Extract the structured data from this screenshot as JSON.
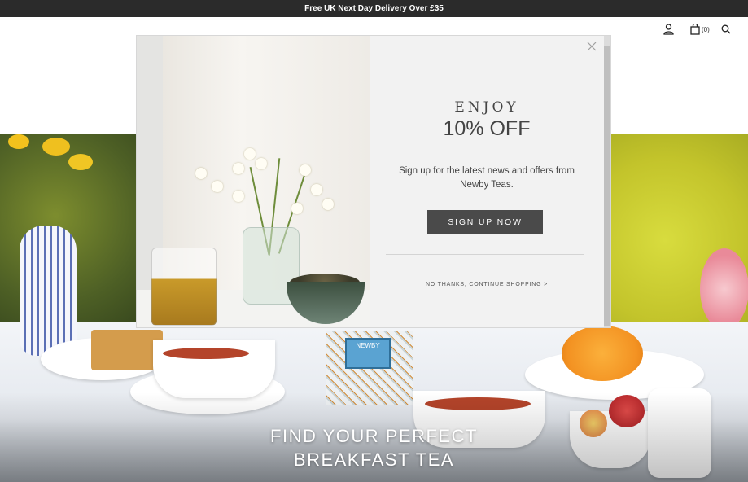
{
  "announcement": {
    "text": "Free UK Next Day Delivery Over £35"
  },
  "header": {
    "account_icon": "user-icon",
    "cart_icon": "bag-icon",
    "cart_count": "(0)",
    "search_icon": "search-icon"
  },
  "hero": {
    "heading_line1": "FIND YOUR PERFECT",
    "heading_line2": "BREAKFAST TEA",
    "tin_brand": "NEWBY"
  },
  "modal": {
    "eyebrow": "ENJOY",
    "offer": "10% OFF",
    "description": "Sign up for the latest news and offers from Newby Teas.",
    "cta_label": "SIGN UP NOW",
    "dismiss_label": "NO THANKS, CONTINUE SHOPPING >",
    "close_icon": "close-icon"
  },
  "colors": {
    "topbar_bg": "#2b2b2b",
    "modal_bg": "#f2f2f2",
    "cta_bg": "#4a4a4a"
  }
}
